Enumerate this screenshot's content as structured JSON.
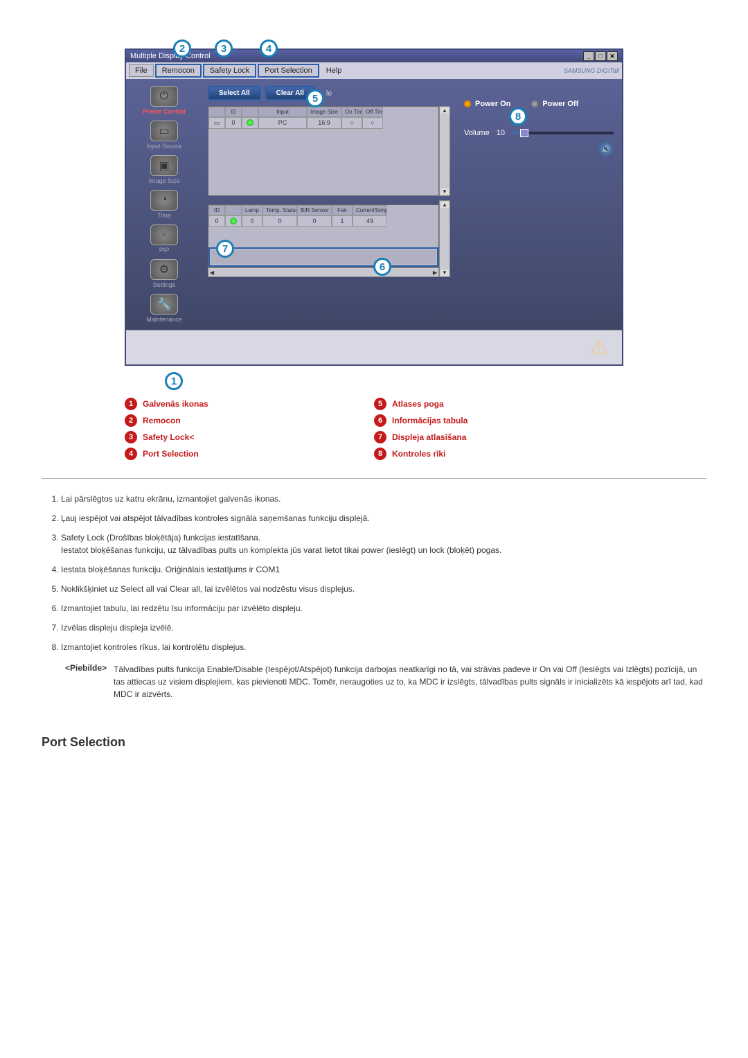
{
  "window": {
    "title": "Multiple Display Control"
  },
  "menu": {
    "file": "File",
    "remocon": "Remocon",
    "safety_lock": "Safety Lock",
    "port_selection": "Port Selection",
    "help": "Help",
    "brand": "SAMSUNG DIGITall"
  },
  "sidebar": {
    "items": [
      {
        "label": "Power Control",
        "icon": "⏻"
      },
      {
        "label": "Input Source",
        "icon": "▭"
      },
      {
        "label": "Image Size",
        "icon": "▣"
      },
      {
        "label": "Time",
        "icon": "◔"
      },
      {
        "label": "PIP",
        "icon": "▫"
      },
      {
        "label": "Settings",
        "icon": "⚙"
      },
      {
        "label": "Maintenance",
        "icon": "🔧"
      }
    ]
  },
  "toolbar": {
    "select_all": "Select All",
    "clear_all": "Clear All",
    "trailing": "le"
  },
  "grid1": {
    "headers": [
      "",
      "ID",
      "",
      "Input",
      "Image Size",
      "On Timer",
      "Off Timer"
    ],
    "row": {
      "id": "0",
      "input": "PC",
      "image_size": "16:9",
      "on_timer": "○",
      "off_timer": "○"
    }
  },
  "grid2": {
    "headers": [
      "ID",
      "",
      "Lamp",
      "Temp. Status",
      "B/R Sensor",
      "Fan",
      "CurrentTemp."
    ],
    "row": {
      "id": "0",
      "lamp": "0",
      "temp_status": "0",
      "br_sensor": "0",
      "fan": "1",
      "current_temp": "49"
    }
  },
  "right_panel": {
    "power_on": "Power On",
    "power_off": "Power Off",
    "volume_label": "Volume",
    "volume_value": "10"
  },
  "legend": {
    "items": [
      {
        "num": "1",
        "text": "Galvenās ikonas"
      },
      {
        "num": "2",
        "text": "Remocon"
      },
      {
        "num": "3",
        "text": "Safety Lock<"
      },
      {
        "num": "4",
        "text": "Port Selection"
      },
      {
        "num": "5",
        "text": "Atlases poga"
      },
      {
        "num": "6",
        "text": "Informācijas tabula"
      },
      {
        "num": "7",
        "text": "Displeja atlasīšana"
      },
      {
        "num": "8",
        "text": "Kontroles rīki"
      }
    ]
  },
  "numbered_list": [
    "Lai pārslēgtos uz katru ekrānu, izmantojiet galvenās ikonas.",
    "Ļauj iespējot vai atspējot tālvadības kontroles signāla saņemšanas funkciju displejā.",
    "Safety Lock (Drošības bloķētāja) funkcijas iestatīšana.\nIestatot bloķēšanas funkciju, uz tālvadības pults un komplekta jūs varat lietot tikai power (ieslēgt) un lock (bloķēt) pogas.",
    "Iestata bloķēšanas funkciju. Oriģinālais iestatījums ir COM1",
    "Noklikšķiniet uz Select all vai Clear all, lai izvēlētos vai nodzēstu visus displejus.",
    "Izmantojiet tabulu, lai redzētu īsu informāciju par izvēlēto displeju.",
    "Izvēlas displeju displeja izvēlē.",
    "Izmantojiet kontroles rīkus, lai kontrolētu displejus."
  ],
  "note": {
    "label": "<Piebilde>",
    "text": "Tālvadības pults funkcija Enable/Disable (Iespējot/Atspējot) funkcija darbojas neatkarīgi no tā, vai strāvas padeve ir On vai Off (Ieslēgts vai Izlēgts) pozīcijā, un tas attiecas uz visiem displejiem, kas pievienoti MDC. Tomēr, neraugoties uz to, ka MDC ir izslēgts, tālvadības pults signāls ir inicializēts kā iespējots arī tad, kad MDC ir aizvērts."
  },
  "section": {
    "port_selection": "Port Selection"
  },
  "callouts": [
    "1",
    "2",
    "3",
    "4",
    "5",
    "6",
    "7",
    "8"
  ]
}
